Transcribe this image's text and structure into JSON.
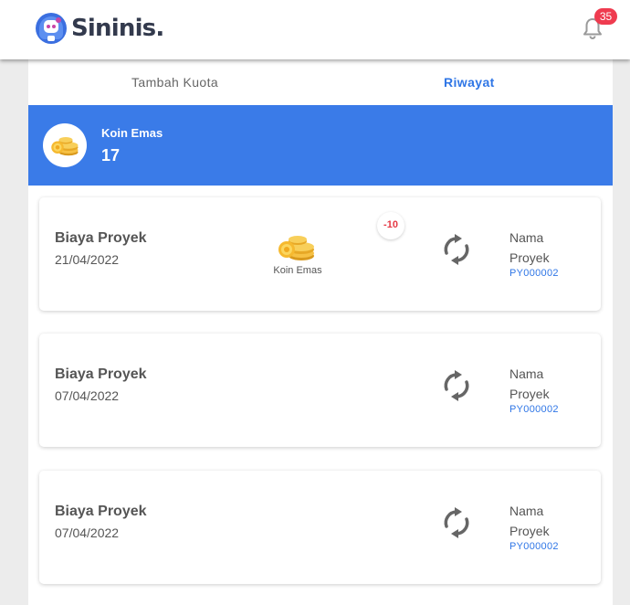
{
  "header": {
    "brand": "Sininis.",
    "notification_count": "35",
    "colors": {
      "brand_dark": "#333a4d",
      "badge": "#ef3b4f"
    }
  },
  "tabs": [
    {
      "label": "Tambah Kuota",
      "active": false
    },
    {
      "label": "Riwayat",
      "active": true
    }
  ],
  "koin": {
    "label": "Koin Emas",
    "value": "17",
    "icon": "coins-icon",
    "accent": "#3a7be8"
  },
  "history": [
    {
      "title": "Biaya Proyek",
      "date": "21/04/2022",
      "coin_label": "Koin Emas",
      "delta": "-10",
      "project_label": "Nama Proyek",
      "project_code": "PY000002"
    },
    {
      "title": "Biaya Proyek",
      "date": "07/04/2022",
      "project_label": "Nama Proyek",
      "project_code": "PY000002"
    },
    {
      "title": "Biaya Proyek",
      "date": "07/04/2022",
      "project_label": "Nama Proyek",
      "project_code": "PY000002"
    }
  ]
}
